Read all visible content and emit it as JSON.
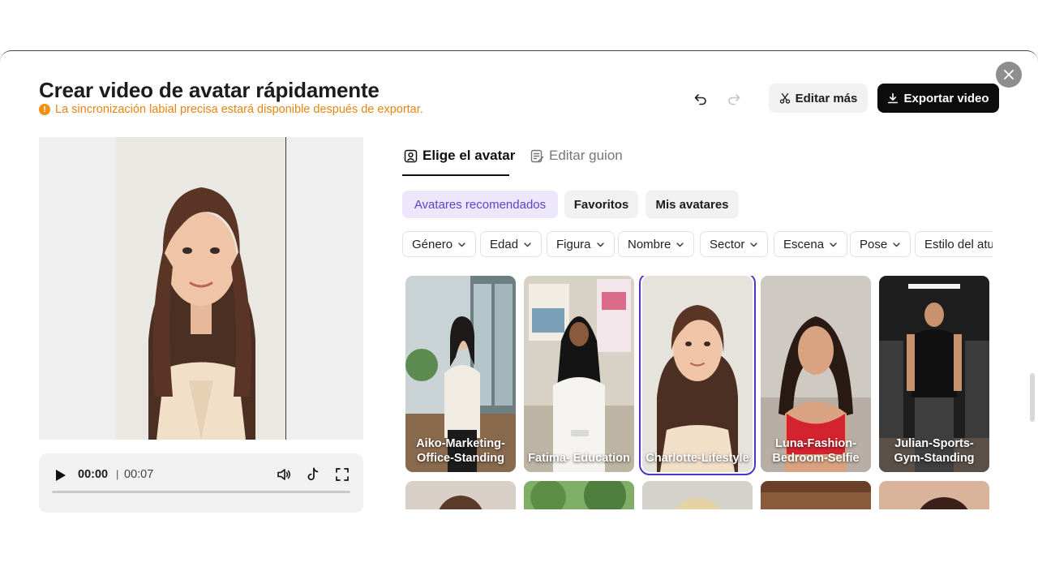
{
  "modal": {
    "title": "Crear video de avatar rápidamente",
    "notice": "La sincronización labial precisa estará disponible después de exportar.",
    "notice_icon": "!"
  },
  "toolbar": {
    "undo_icon": "undo-icon",
    "redo_icon": "redo-icon",
    "edit_more_label": "Editar más",
    "export_label": "Exportar video"
  },
  "player": {
    "current_time": "00:00",
    "separator": "|",
    "total_time": "00:07",
    "progress": 0
  },
  "tabs": [
    {
      "label": "Elige el avatar",
      "active": true
    },
    {
      "label": "Editar guion",
      "active": false
    }
  ],
  "segments": [
    {
      "label": "Avatares recomendados",
      "active": true
    },
    {
      "label": "Favoritos",
      "active": false
    },
    {
      "label": "Mis avatares",
      "active": false
    }
  ],
  "filters": [
    "Género",
    "Edad",
    "Figura",
    "Nombre",
    "Sector",
    "Escena",
    "Pose",
    "Estilo del atuendo"
  ],
  "avatars": [
    {
      "name": "Aiko-Marketing-Office-Standing"
    },
    {
      "name": "Fatima- Education"
    },
    {
      "name": "Charlotte-Lifestyle",
      "selected": true
    },
    {
      "name": "Luna-Fashion-Bedroom-Selfie"
    },
    {
      "name": "Julian-Sports-Gym-Standing"
    }
  ],
  "colors": {
    "accent": "#5c43c9",
    "warning": "#f29111",
    "export_bg": "#0c0c0c"
  }
}
